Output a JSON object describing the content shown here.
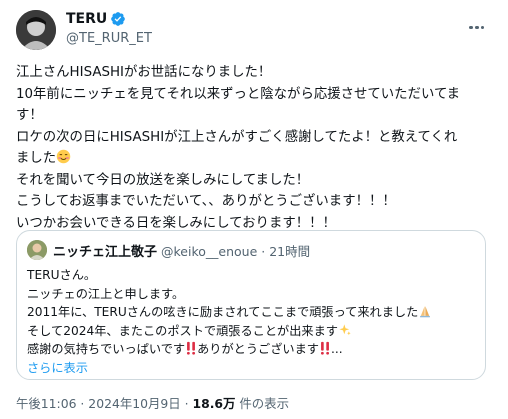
{
  "author": {
    "display_name": "TERU",
    "handle": "@TE_RUR_ET",
    "verified": true
  },
  "tweet": {
    "lines": [
      "江上さんHISASHIがお世話になりました！",
      "10年前にニッチェを見てそれ以来ずっと陰ながら応援させていただいてま",
      "す！",
      "ロケの次の日にHISASHIが江上さんがすごく感謝してたよ！と教えてくれ",
      "ました",
      "それを聞いて今日の放送を楽しみにしてました！",
      "こうしてお返事までいただいて、、ありがとうございます！！！",
      "いつかお会いできる日を楽しみにしております！！！"
    ],
    "emoji_after_line_4": "smiling-blush-emoji"
  },
  "quote": {
    "display_name": "ニッチェ江上敬子",
    "handle_time": "@keiko__enoue · 21時間",
    "lines": [
      "TERUさん。",
      "ニッチェの江上と申します。",
      "2011年に、TERUさんの呟きに励まされてここまで頑張って来れました",
      "そして2024年、またこのポストで頑張ることが出来ます",
      "感謝の気持ちでいっぱいです",
      "ありがとうございます",
      "..."
    ],
    "show_more": "さらに表示"
  },
  "meta": {
    "timestamp": "午後11:06 · 2024年10月9日 · ",
    "views_count": "18.6万",
    "views_label": " 件の表示"
  },
  "colors": {
    "accent": "#1d9bf0",
    "text": "#0f1419",
    "muted": "#536471",
    "border": "#cfd9de"
  }
}
